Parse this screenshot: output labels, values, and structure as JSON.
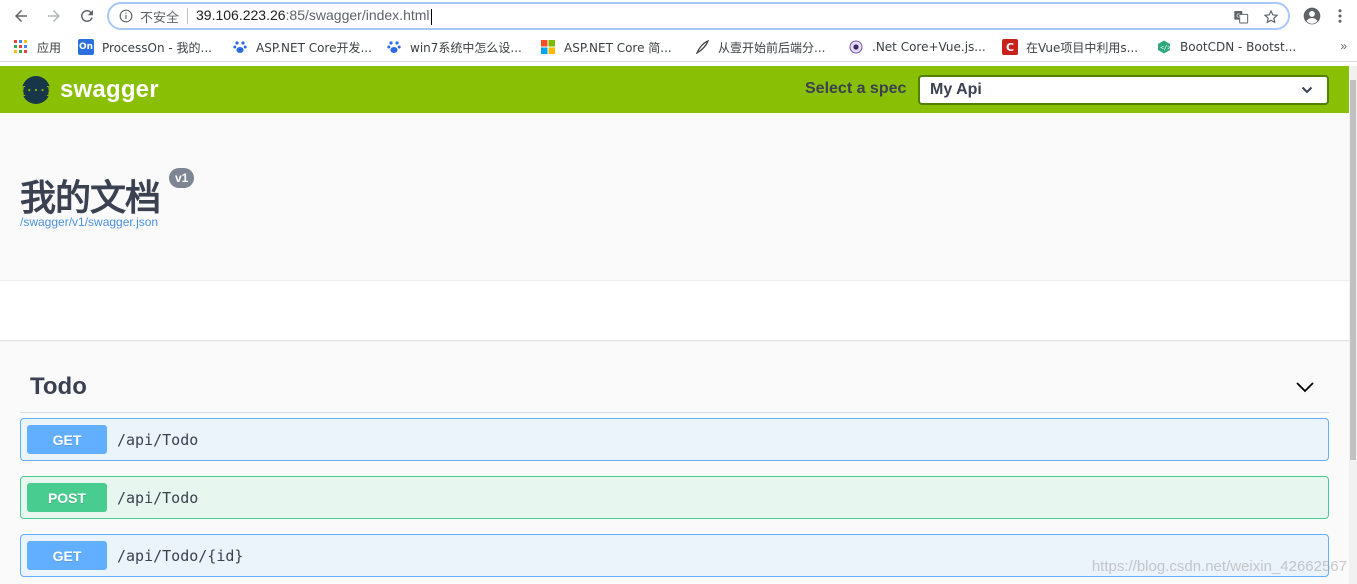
{
  "browser": {
    "security_label": "不安全",
    "url_host": "39.106.223.26",
    "url_rest": ":85/swagger/index.html",
    "bookmarks": [
      {
        "label": "应用",
        "icon": "apps-grid-icon"
      },
      {
        "label": "ProcessOn - 我的...",
        "icon": "processon-icon"
      },
      {
        "label": "ASP.NET Core开发...",
        "icon": "baidu-paw-icon"
      },
      {
        "label": "win7系统中怎么设...",
        "icon": "baidu-paw-icon"
      },
      {
        "label": "ASP.NET Core 简...",
        "icon": "microsoft-logo-icon"
      },
      {
        "label": "从壹开始前后端分...",
        "icon": "feather-icon"
      },
      {
        "label": ".Net Core+Vue.js...",
        "icon": "eye-logo-icon"
      },
      {
        "label": "在Vue项目中利用s...",
        "icon": "csdn-icon"
      },
      {
        "label": "BootCDN - Bootst...",
        "icon": "bootcdn-icon"
      }
    ],
    "bookmarks_more": "»"
  },
  "swagger": {
    "logo_glyph": "{···}",
    "logo_text": "swagger",
    "select_label": "Select a spec",
    "select_value": "My Api",
    "title": "我的文档",
    "version": "v1",
    "spec_url": "/swagger/v1/swagger.json",
    "tag": {
      "name": "Todo",
      "operations": [
        {
          "method": "GET",
          "path": "/api/Todo"
        },
        {
          "method": "POST",
          "path": "/api/Todo"
        },
        {
          "method": "GET",
          "path": "/api/Todo/{id}"
        }
      ]
    }
  },
  "watermark": "https://blog.csdn.net/weixin_42662567",
  "colors": {
    "swagger_green": "#89bf04",
    "get_blue": "#61affe",
    "post_green": "#49cc90",
    "text_dark": "#3b4151",
    "link_blue": "#4990e2"
  }
}
